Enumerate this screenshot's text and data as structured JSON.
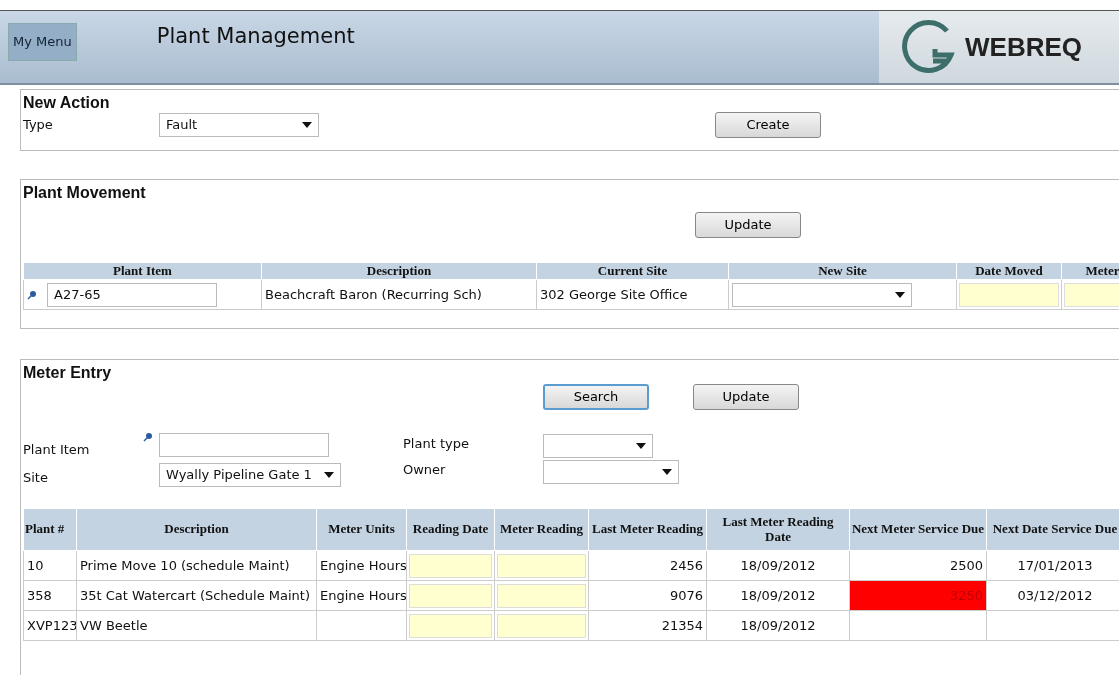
{
  "header": {
    "menu_button": "My Menu",
    "title": "Plant Management",
    "logo_text": "WEBREQ"
  },
  "new_action": {
    "title": "New Action",
    "type_label": "Type",
    "type_value": "Fault",
    "button": "Create"
  },
  "plant_movement": {
    "title": "Plant Movement",
    "button": "Update",
    "columns": [
      "Plant Item",
      "Description",
      "Current Site",
      "New Site",
      "Date Moved",
      "Meter"
    ],
    "rows": [
      {
        "plant_item": "A27-65",
        "description": "Beachcraft Baron (Recurring Sch)",
        "current_site": "302 George Site Office"
      }
    ]
  },
  "meter_entry": {
    "title": "Meter Entry",
    "search_button": "Search",
    "update_button": "Update",
    "plant_item_label": "Plant Item",
    "site_label": "Site",
    "site_value": "Wyally Pipeline Gate 1",
    "plant_type_label": "Plant type",
    "owner_label": "Owner",
    "columns": [
      "Plant #",
      "Description",
      "Meter Units",
      "Reading Date",
      "Meter Reading",
      "Last Meter Reading",
      "Last Meter Reading Date",
      "Next Meter Service Due",
      "Next Date Service Due"
    ],
    "rows": [
      {
        "plant": "10",
        "description": "Prime Move 10 (schedule Maint)",
        "units": "Engine Hours",
        "last_reading": "2456",
        "last_date": "18/09/2012",
        "next_due": "2500",
        "overdue": false,
        "next_date": "17/01/2013"
      },
      {
        "plant": "358",
        "description": "35t Cat Watercart (Schedule Maint)",
        "units": "Engine Hours",
        "last_reading": "9076",
        "last_date": "18/09/2012",
        "next_due": "3250",
        "overdue": true,
        "next_date": "03/12/2012"
      },
      {
        "plant": "XVP123",
        "description": "VW Beetle",
        "last_reading": "21354",
        "last_date": "18/09/2012"
      }
    ]
  }
}
